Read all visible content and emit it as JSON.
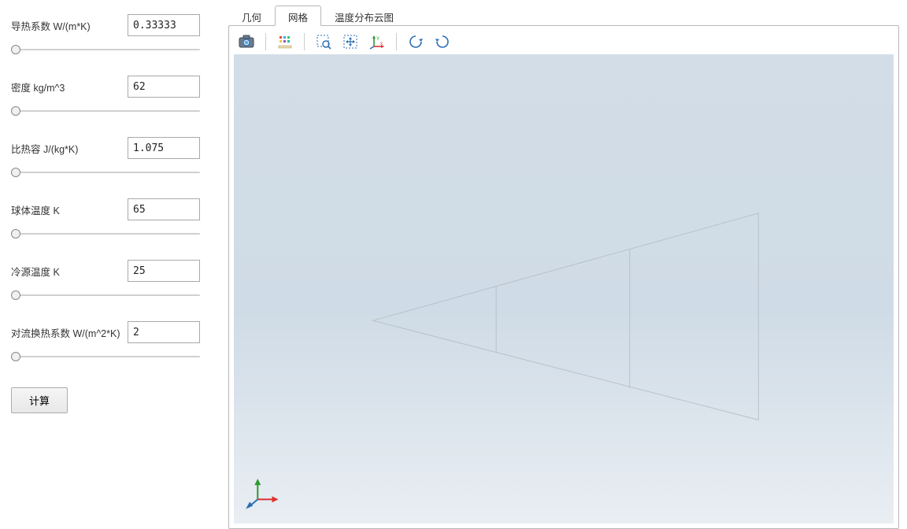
{
  "params": [
    {
      "label": "导热系数 W/(m*K)",
      "value": "0.33333"
    },
    {
      "label": "密度 kg/m^3",
      "value": "62"
    },
    {
      "label": "比热容 J/(kg*K)",
      "value": "1.075"
    },
    {
      "label": "球体温度 K",
      "value": "65"
    },
    {
      "label": "冷源温度 K",
      "value": "25"
    },
    {
      "label": "对流换热系数 W/(m^2*K)",
      "value": "2"
    }
  ],
  "buttons": {
    "calculate": "计算"
  },
  "tabs": [
    {
      "label": "几何",
      "active": false
    },
    {
      "label": "网格",
      "active": true
    },
    {
      "label": "温度分布云图",
      "active": false
    }
  ],
  "toolbar_icons": [
    "camera-icon",
    "isometric-view-icon",
    "zoom-area-icon",
    "pan-icon",
    "axes-toggle-icon",
    "rotate-left-icon",
    "rotate-right-icon"
  ]
}
